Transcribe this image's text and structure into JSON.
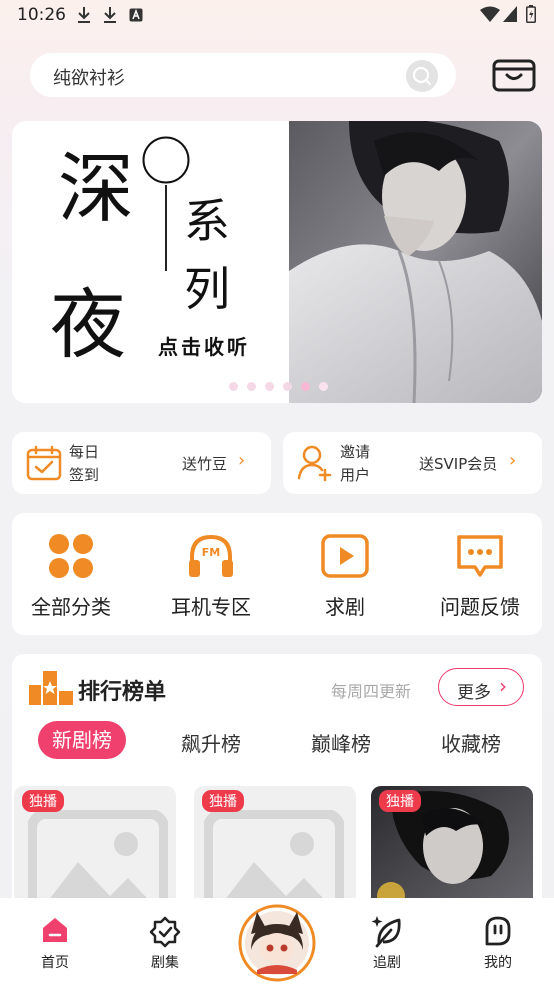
{
  "status_bar": {
    "time": "10:26"
  },
  "search": {
    "query": "纯欲衬衫"
  },
  "banner": {
    "title_chars": [
      "深",
      "夜",
      "系",
      "列"
    ],
    "subtitle": "点击收听",
    "slide_count": 6,
    "active_slide": 4
  },
  "quick_actions": [
    {
      "label_line1": "每日",
      "label_line2": "签到",
      "reward": "送竹豆",
      "icon": "calendar-check-icon"
    },
    {
      "label_line1": "邀请",
      "label_line2": "用户",
      "reward": "送SVIP会员",
      "icon": "add-user-icon"
    }
  ],
  "functions": [
    {
      "label": "全部分类",
      "icon": "grid-icon"
    },
    {
      "label": "耳机专区",
      "icon": "headphones-fm-icon"
    },
    {
      "label": "求剧",
      "icon": "play-icon"
    },
    {
      "label": "问题反馈",
      "icon": "chat-bubble-icon"
    }
  ],
  "ranking": {
    "title": "排行榜单",
    "update_note": "每周四更新",
    "more_label": "更多",
    "tabs": [
      "新剧榜",
      "飙升榜",
      "巅峰榜",
      "收藏榜"
    ],
    "active_tab": 0,
    "items": [
      {
        "badge": "独播",
        "image": "placeholder"
      },
      {
        "badge": "独播",
        "image": "placeholder"
      },
      {
        "badge": "独播",
        "image": "cover-art"
      }
    ]
  },
  "bottom_nav": [
    {
      "label": "首页",
      "icon": "home-icon",
      "active": true
    },
    {
      "label": "剧集",
      "icon": "badge-check-icon",
      "active": false
    },
    {
      "label": "",
      "icon": "avatar-center",
      "active": false
    },
    {
      "label": "追剧",
      "icon": "leaf-icon",
      "active": false
    },
    {
      "label": "我的",
      "icon": "profile-face-icon",
      "active": false
    }
  ],
  "colors": {
    "accent_orange": "#f08a24",
    "accent_pink": "#f0406e",
    "badge_red": "#ee3b4c"
  }
}
